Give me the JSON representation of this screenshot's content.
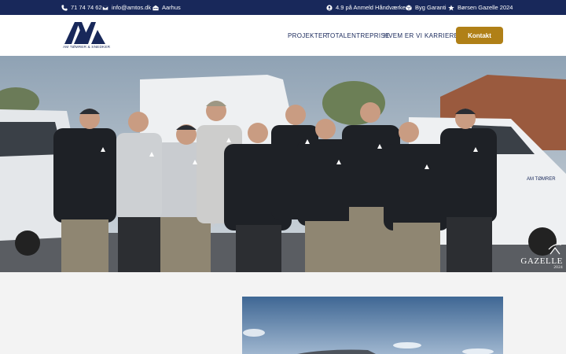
{
  "topbar": {
    "phone": "71 74 74 62",
    "email": "info@amtos.dk",
    "city": "Aarhus",
    "rating": "4.9 på Anmeld Håndværker",
    "guarantee": "Byg Garanti",
    "award": "Børsen Gazelle 2024"
  },
  "header": {
    "logo_text": "AM TØMRER & SNEDKER",
    "nav": [
      "PROJEKTER",
      "TOTALENTREPRISE",
      "HVEM ER VI",
      "KARRIERE"
    ],
    "cta_label": "Kontakt"
  },
  "hero": {
    "badge_title": "GAZELLE",
    "badge_year": "2024",
    "van_lettering": "AM TØMRER & SNEDKER"
  },
  "colors": {
    "navy": "#18285a",
    "gold": "#b08017",
    "white": "#ffffff",
    "page_bg": "#f3f3f3"
  },
  "icons": [
    "phone-icon",
    "envelope-icon",
    "building-icon",
    "user-circle-icon",
    "cube-icon",
    "star-icon"
  ]
}
